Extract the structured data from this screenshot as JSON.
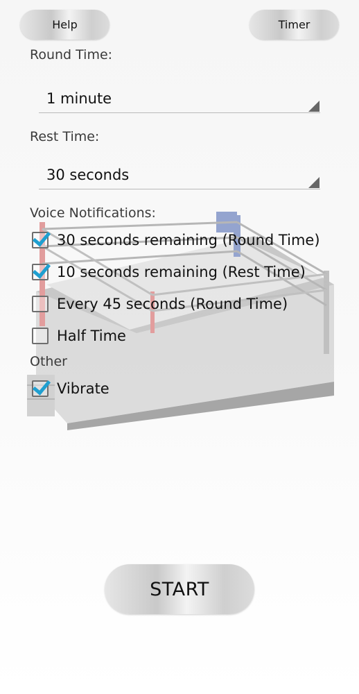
{
  "header": {
    "help_label": "Help",
    "timer_label": "Timer"
  },
  "round_time": {
    "label": "Round Time:",
    "value": "1 minute"
  },
  "rest_time": {
    "label": "Rest Time:",
    "value": "30 seconds"
  },
  "voice_notifications": {
    "label": "Voice Notifications:",
    "items": [
      {
        "label": "30 seconds remaining (Round Time)",
        "checked": true
      },
      {
        "label": "10 seconds remaining (Rest Time)",
        "checked": true
      },
      {
        "label": "Every 45 seconds (Round Time)",
        "checked": false
      },
      {
        "label": "Half Time",
        "checked": false
      }
    ]
  },
  "other": {
    "label": "Other",
    "items": [
      {
        "label": "Vibrate",
        "checked": true
      }
    ]
  },
  "start_label": "START",
  "colors": {
    "check_accent": "#1f9fd0",
    "button_silver": "#d0d0d0"
  }
}
